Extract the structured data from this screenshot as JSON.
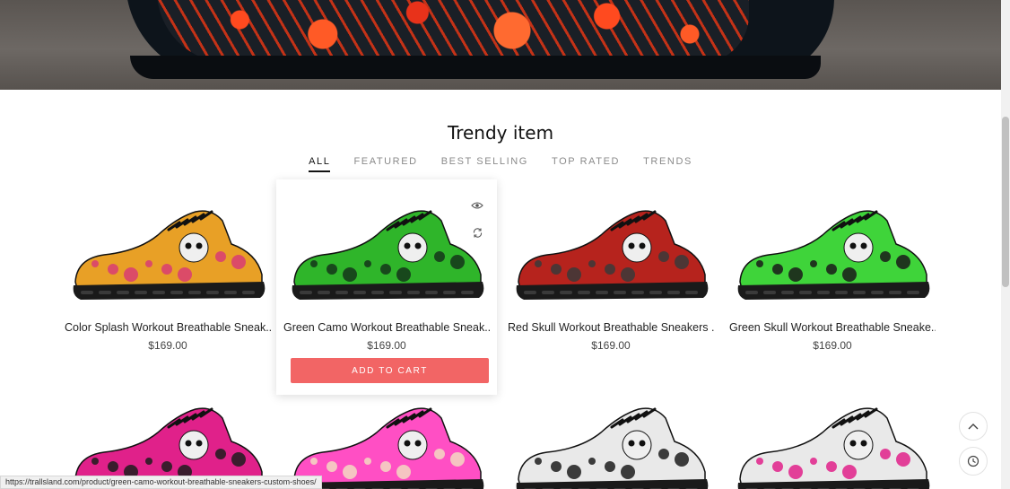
{
  "hero": {
    "image": "red-mandala-sneaker-banner"
  },
  "section": {
    "title": "Trendy item"
  },
  "tabs": [
    {
      "label": "ALL",
      "active": true
    },
    {
      "label": "FEATURED",
      "active": false
    },
    {
      "label": "BEST SELLING",
      "active": false
    },
    {
      "label": "TOP RATED",
      "active": false
    },
    {
      "label": "TRENDS",
      "active": false
    }
  ],
  "products": [
    {
      "name": "Color Splash Workout Breathable Sneak...",
      "price": "$169.00",
      "colors": {
        "main": "#e8a026",
        "accent": "#d83c74"
      }
    },
    {
      "name": "Green Camo Workout Breathable Sneak...",
      "price": "$169.00",
      "colors": {
        "main": "#2fb52a",
        "accent": "#14351a"
      },
      "hovered": true
    },
    {
      "name": "Red Skull Workout Breathable Sneakers ...",
      "price": "$169.00",
      "colors": {
        "main": "#b6231d",
        "accent": "#3a3a3a"
      }
    },
    {
      "name": "Green Skull Workout Breathable Sneake...",
      "price": "$169.00",
      "colors": {
        "main": "#3fd43a",
        "accent": "#1a1a1a"
      }
    }
  ],
  "products_row2": [
    {
      "colors": {
        "main": "#e0218a",
        "accent": "#1c1c1c"
      }
    },
    {
      "colors": {
        "main": "#ff4fc4",
        "accent": "#f3d9c2"
      }
    },
    {
      "colors": {
        "main": "#e9e9e9",
        "accent": "#1c1c1c"
      }
    },
    {
      "colors": {
        "main": "#e9e9e9",
        "accent": "#e0218a"
      }
    }
  ],
  "add_to_cart_label": "ADD TO CART",
  "status_url": "https://trallsland.com/product/green-camo-workout-breathable-sneakers-custom-shoes/",
  "accent_color": "#f26565"
}
